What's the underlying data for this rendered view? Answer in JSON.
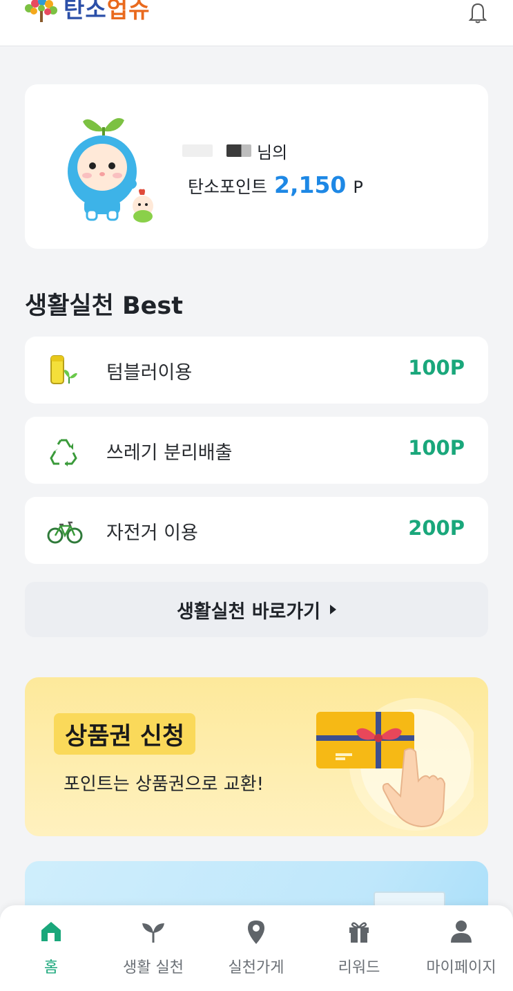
{
  "header": {
    "logo": {
      "part1": "탄소",
      "part2": "업슈"
    },
    "icons": {
      "logo": "leaf-tree-logo",
      "notification": "bell-icon"
    }
  },
  "profile": {
    "name_suffix": "님의",
    "point_label": "탄소포인트",
    "point_value": "2,150",
    "point_unit": "P",
    "mascot": "sprout-mascot-character"
  },
  "best_section": {
    "title": "생활실천 Best",
    "items": [
      {
        "label": "텀블러이용",
        "points": "100P",
        "icon": "tumbler-icon"
      },
      {
        "label": "쓰레기 분리배출",
        "points": "100P",
        "icon": "recycle-icon"
      },
      {
        "label": "자전거 이용",
        "points": "200P",
        "icon": "bicycle-icon"
      }
    ],
    "shortcut_label": "생활실천 바로가기"
  },
  "gift_banner": {
    "title": "상품권 신청",
    "subtitle": "포인트는 상품권으로 교환!",
    "art": "gift-card-hand-icon"
  },
  "bottom_nav": {
    "items": [
      {
        "label": "홈",
        "icon": "home-icon",
        "active": true
      },
      {
        "label": "생활 실천",
        "icon": "sprout-icon",
        "active": false
      },
      {
        "label": "실천가게",
        "icon": "location-pin-icon",
        "active": false
      },
      {
        "label": "리워드",
        "icon": "gift-icon",
        "active": false
      },
      {
        "label": "마이페이지",
        "icon": "person-icon",
        "active": false
      }
    ]
  },
  "colors": {
    "accent_green": "#1aa77b",
    "point_blue": "#1e88e5",
    "logo_blue": "#2b4fa8",
    "logo_orange": "#e96a1e",
    "banner_yellow": "#fde99b"
  }
}
